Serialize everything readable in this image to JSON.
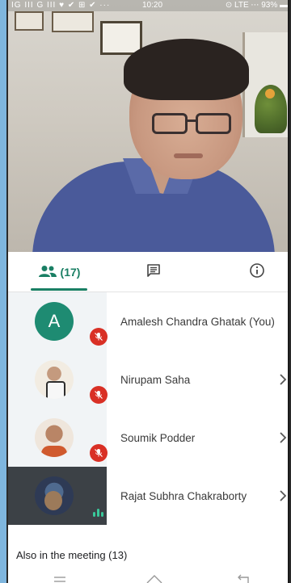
{
  "statusbar": {
    "left": "IG III G III ♥ ✔ ⊞ ✔ ···",
    "time": "10:20",
    "right": "⊙ LTE ⋯ 93% ▬"
  },
  "tabs": {
    "people_count": "(17)",
    "people_icon": "people-icon",
    "chat_icon": "chat-icon",
    "info_icon": "info-icon",
    "active": "people"
  },
  "participants": [
    {
      "name": "Amalesh Chandra Ghatak (You)",
      "avatar_letter": "A",
      "muted": true,
      "has_chevron": false
    },
    {
      "name": "Nirupam Saha",
      "muted": true,
      "has_chevron": true
    },
    {
      "name": "Soumik Podder",
      "muted": true,
      "has_chevron": true
    },
    {
      "name": "Rajat Subhra Chakraborty",
      "muted": false,
      "speaking": true,
      "has_chevron": true
    }
  ],
  "also_in_meeting": "Also in the meeting (13)",
  "colors": {
    "accent": "#1a7f64",
    "muted_badge": "#d93025",
    "avatar_bg": "#1e8b72"
  },
  "nav": {
    "menu_icon": "menu-icon",
    "home_icon": "home-icon",
    "back_icon": "back-icon"
  }
}
